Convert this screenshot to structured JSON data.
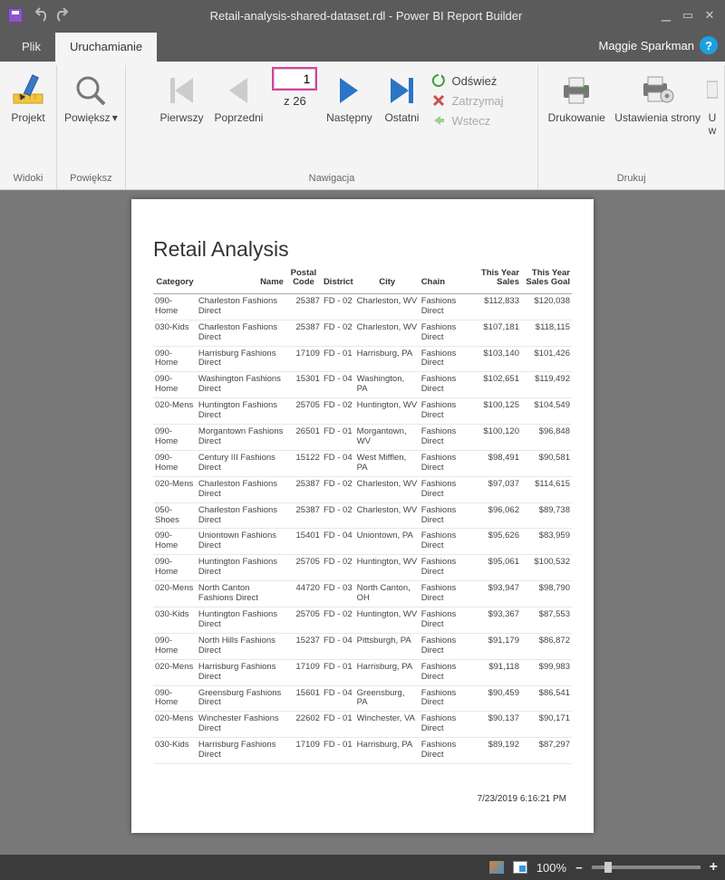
{
  "window": {
    "title": "Retail-analysis-shared-dataset.rdl - Power BI Report Builder",
    "user": "Maggie Sparkman"
  },
  "tabs": {
    "file": "Plik",
    "run": "Uruchamianie"
  },
  "ribbon": {
    "views_group": "Widoki",
    "zoom_group": "Powiększ",
    "nav_group": "Nawigacja",
    "print_group": "Drukuj",
    "projekt": "Projekt",
    "powieksz": "Powiększ",
    "first": "Pierwszy",
    "prev": "Poprzedni",
    "next": "Następny",
    "last": "Ostatni",
    "page_value": "1",
    "page_total": "z 26",
    "refresh": "Odśwież",
    "stop": "Zatrzymaj",
    "back": "Wstecz",
    "print": "Drukowanie",
    "page_setup": "Ustawienia strony",
    "extra": "U\nw"
  },
  "report": {
    "title": "Retail Analysis",
    "columns": [
      "Category",
      "Name",
      "Postal Code",
      "District",
      "City",
      "Chain",
      "This Year Sales",
      "This Year Sales Goal"
    ],
    "rows": [
      {
        "cat": "090-Home",
        "name": "Charleston Fashions Direct",
        "postal": "25387",
        "district": "FD - 02",
        "city": "Charleston, WV",
        "chain": "Fashions Direct",
        "sales": "$112,833",
        "goal": "$120,038"
      },
      {
        "cat": "030-Kids",
        "name": "Charleston Fashions Direct",
        "postal": "25387",
        "district": "FD - 02",
        "city": "Charleston, WV",
        "chain": "Fashions Direct",
        "sales": "$107,181",
        "goal": "$118,115"
      },
      {
        "cat": "090-Home",
        "name": "Harrisburg Fashions Direct",
        "postal": "17109",
        "district": "FD - 01",
        "city": "Harrisburg, PA",
        "chain": "Fashions Direct",
        "sales": "$103,140",
        "goal": "$101,426"
      },
      {
        "cat": "090-Home",
        "name": "Washington Fashions Direct",
        "postal": "15301",
        "district": "FD - 04",
        "city": "Washington, PA",
        "chain": "Fashions Direct",
        "sales": "$102,651",
        "goal": "$119,492"
      },
      {
        "cat": "020-Mens",
        "name": "Huntington Fashions Direct",
        "postal": "25705",
        "district": "FD - 02",
        "city": "Huntington, WV",
        "chain": "Fashions Direct",
        "sales": "$100,125",
        "goal": "$104,549"
      },
      {
        "cat": "090-Home",
        "name": "Morgantown Fashions Direct",
        "postal": "26501",
        "district": "FD - 01",
        "city": "Morgantown, WV",
        "chain": "Fashions Direct",
        "sales": "$100,120",
        "goal": "$96,848"
      },
      {
        "cat": "090-Home",
        "name": "Century III Fashions Direct",
        "postal": "15122",
        "district": "FD - 04",
        "city": "West Mifflen, PA",
        "chain": "Fashions Direct",
        "sales": "$98,491",
        "goal": "$90,581"
      },
      {
        "cat": "020-Mens",
        "name": "Charleston Fashions Direct",
        "postal": "25387",
        "district": "FD - 02",
        "city": "Charleston, WV",
        "chain": "Fashions Direct",
        "sales": "$97,037",
        "goal": "$114,615"
      },
      {
        "cat": "050-Shoes",
        "name": "Charleston Fashions Direct",
        "postal": "25387",
        "district": "FD - 02",
        "city": "Charleston, WV",
        "chain": "Fashions Direct",
        "sales": "$96,062",
        "goal": "$89,738"
      },
      {
        "cat": "090-Home",
        "name": "Uniontown Fashions Direct",
        "postal": "15401",
        "district": "FD - 04",
        "city": "Uniontown, PA",
        "chain": "Fashions Direct",
        "sales": "$95,626",
        "goal": "$83,959"
      },
      {
        "cat": "090-Home",
        "name": "Huntington Fashions Direct",
        "postal": "25705",
        "district": "FD - 02",
        "city": "Huntington, WV",
        "chain": "Fashions Direct",
        "sales": "$95,061",
        "goal": "$100,532"
      },
      {
        "cat": "020-Mens",
        "name": "North Canton Fashions Direct",
        "postal": "44720",
        "district": "FD - 03",
        "city": "North Canton, OH",
        "chain": "Fashions Direct",
        "sales": "$93,947",
        "goal": "$98,790"
      },
      {
        "cat": "030-Kids",
        "name": "Huntington Fashions Direct",
        "postal": "25705",
        "district": "FD - 02",
        "city": "Huntington, WV",
        "chain": "Fashions Direct",
        "sales": "$93,367",
        "goal": "$87,553"
      },
      {
        "cat": "090-Home",
        "name": "North Hills Fashions Direct",
        "postal": "15237",
        "district": "FD - 04",
        "city": "Pittsburgh, PA",
        "chain": "Fashions Direct",
        "sales": "$91,179",
        "goal": "$86,872"
      },
      {
        "cat": "020-Mens",
        "name": "Harrisburg Fashions Direct",
        "postal": "17109",
        "district": "FD - 01",
        "city": "Harrisburg, PA",
        "chain": "Fashions Direct",
        "sales": "$91,118",
        "goal": "$99,983"
      },
      {
        "cat": "090-Home",
        "name": "Greensburg Fashions Direct",
        "postal": "15601",
        "district": "FD - 04",
        "city": "Greensburg, PA",
        "chain": "Fashions Direct",
        "sales": "$90,459",
        "goal": "$86,541"
      },
      {
        "cat": "020-Mens",
        "name": "Winchester Fashions Direct",
        "postal": "22602",
        "district": "FD - 01",
        "city": "Winchester, VA",
        "chain": "Fashions Direct",
        "sales": "$90,137",
        "goal": "$90,171"
      },
      {
        "cat": "030-Kids",
        "name": "Harrisburg Fashions Direct",
        "postal": "17109",
        "district": "FD - 01",
        "city": "Harrisburg, PA",
        "chain": "Fashions Direct",
        "sales": "$89,192",
        "goal": "$87,297"
      }
    ],
    "timestamp": "7/23/2019 6:16:21 PM"
  },
  "status": {
    "zoom": "100%"
  }
}
